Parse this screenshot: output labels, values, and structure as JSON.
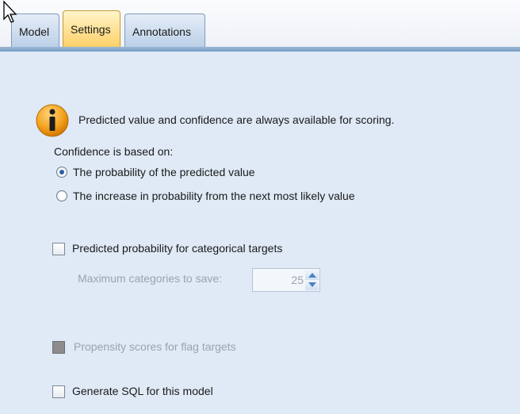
{
  "tabs": [
    {
      "label": "Model"
    },
    {
      "label": "Settings"
    },
    {
      "label": "Annotations"
    }
  ],
  "info": {
    "message": "Predicted value and confidence are always available for scoring."
  },
  "confidence": {
    "label": "Confidence is based on:",
    "options": [
      {
        "label": "The probability of the predicted value",
        "selected": true
      },
      {
        "label": "The increase in probability from the next most likely value",
        "selected": false
      }
    ]
  },
  "predicted_probability": {
    "label": "Predicted probability for categorical targets",
    "checked": false,
    "max_categories_label": "Maximum categories to save:",
    "max_categories_value": "25"
  },
  "propensity": {
    "label": "Propensity scores for flag targets",
    "enabled": false
  },
  "generate_sql": {
    "label": "Generate SQL for this model",
    "checked": false
  },
  "colors": {
    "selected_tab": "#ffd16a",
    "panel": "#dfeaf6",
    "disabled_text": "#9aa3ad"
  }
}
